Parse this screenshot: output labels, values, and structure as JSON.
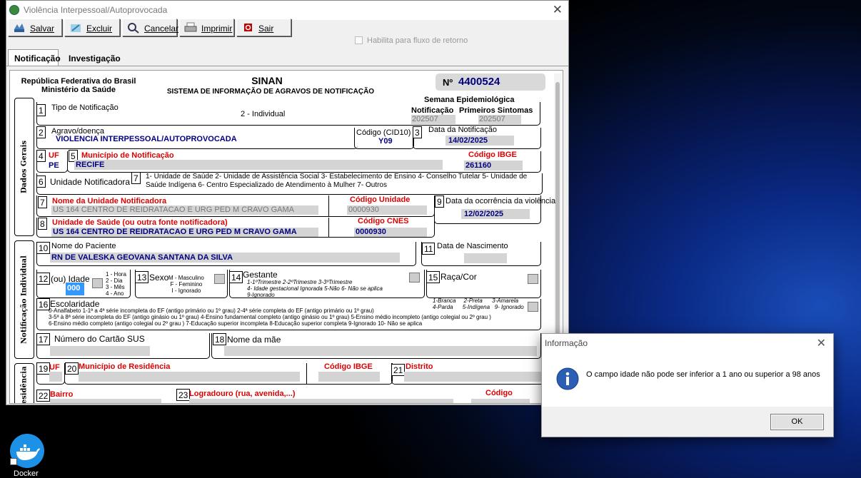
{
  "window": {
    "title": "Violência Interpessoal/Autoprovocada",
    "close": "✕"
  },
  "toolbar": {
    "save": "Salvar",
    "delete": "Excluir",
    "cancel": "Cancelar",
    "print": "Imprimir",
    "exit": "Sair"
  },
  "flow_checkbox": "Habilita para fluxo de retorno",
  "tabs": [
    "Notificação",
    "Investigação"
  ],
  "header": {
    "republic": "República Federativa do Brasil",
    "ministry": "Ministério da Saúde",
    "sinan": "SINAN",
    "system": "SISTEMA DE INFORMAÇÃO  DE AGRAVOS DE NOTIFICAÇÃO",
    "number_label": "Nº",
    "number": "4400524"
  },
  "side_labels": {
    "general": "Dados Gerais",
    "individual": "Notificação Individual",
    "residence": "Residência"
  },
  "f1": {
    "n": "1",
    "label": "Tipo de Notificação",
    "value": "2 - Individual",
    "week_title": "Semana Epidemiológica",
    "week_notif": "Notificação",
    "week_sympt": "Primeiros Sintomas",
    "week_notif_val": "202507",
    "week_sympt_val": "202507"
  },
  "f2": {
    "n": "2",
    "label": "Agravo/doença",
    "value": "VIOLENCIA INTERPESSOAL/AUTOPROVOCADA",
    "cid_label": "Código (CID10)",
    "cid": "Y09"
  },
  "f3": {
    "n": "3",
    "label": "Data da Notificação",
    "value": "14/02/2025"
  },
  "f4": {
    "n": "4",
    "label": "UF",
    "value": "PE"
  },
  "f5": {
    "n": "5",
    "label": "Município de Notificação",
    "value": "RECIFE",
    "ibge_label": "Código IBGE",
    "ibge": "261160"
  },
  "f6": {
    "n": "6",
    "label": "Unidade Notificadora",
    "n7": "7",
    "options": "1- Unidade de Saúde  2- Unidade de Assistência Social  3- Estabelecimento de Ensino  4- Conselho Tutelar  5- Unidade de Saúde Indígena  6- Centro Especializado de Atendimento à Mulher  7- Outros"
  },
  "f7": {
    "n": "7",
    "label": "Nome da Unidade Notificadora",
    "value": "US 164 CENTRO DE REIDRATACAO E URG PED M CRAVO GAMA",
    "code_label": "Código Unidade",
    "code": "0000930"
  },
  "f8": {
    "n": "8",
    "label": "Unidade de Saúde (ou outra fonte notificadora)",
    "value": "US 164 CENTRO DE REIDRATACAO E URG PED M CRAVO GAMA",
    "cnes_label": "Código CNES",
    "cnes": "0000930"
  },
  "f9": {
    "n": "9",
    "label": "Data da ocorrência da violência",
    "value": "12/02/2025"
  },
  "f10": {
    "n": "10",
    "label": "Nome do Paciente",
    "value": "RN DE VALESKA GEOVANA SANTANA DA SILVA"
  },
  "f11": {
    "n": "11",
    "label": "Data de Nascimento"
  },
  "f12": {
    "n": "12",
    "label": "(ou) Idade",
    "value": "000",
    "units": [
      "1 - Hora",
      "2 - Dia",
      "3 - Mês",
      "4 - Ano"
    ]
  },
  "f13": {
    "n": "13",
    "label": "Sexo",
    "options": [
      "M - Masculino",
      "F - Feminino",
      "I - Ignorado"
    ]
  },
  "f14": {
    "n": "14",
    "label": "Gestante",
    "l1": "1-1ºTrimestre   2-2ºTrimestre   3-3ºTrimestre",
    "l2": "4- Idade gestacional Ignorada   5-Não   6- Não se aplica",
    "l3": "9-Ignorado"
  },
  "f15": {
    "n": "15",
    "label": "Raça/Cor",
    "l1": "1-Branca     2-Preta      3-Amarela",
    "l2": "4-Parda      5-Indígena   9- Ignorado"
  },
  "f16": {
    "n": "16",
    "label": "Escolaridade",
    "l1": "0-Analfabeto    1-1ª a 4ª série incompleta do EF (antigo primário ou 1º grau)     2-4ª série completa do EF (antigo primário ou 1º grau)",
    "l2": "3-5ª à 8ª série incompleta do EF (antigo ginásio ou 1º grau)    4-Ensino fundamental completo (antigo ginásio ou 1º grau)    5-Ensino médio incompleto (antigo colegial  ou 2º grau )",
    "l3": "6-Ensino médio completo (antigo colegial  ou 2º grau )   7-Educação superior incompleta     8-Educação superior completa     9-Ignorado    10- Não se aplica"
  },
  "f17": {
    "n": "17",
    "label": "Número do Cartão SUS"
  },
  "f18": {
    "n": "18",
    "label": "Nome da mãe"
  },
  "f19": {
    "n": "19",
    "label": "UF"
  },
  "f20": {
    "n": "20",
    "label": "Município de Residência",
    "ibge_label": "Código IBGE"
  },
  "f21": {
    "n": "21",
    "label": "Distrito"
  },
  "f22": {
    "n": "22",
    "label": "Bairro"
  },
  "f23": {
    "n": "23",
    "label": "Logradouro (rua, avenida,...)",
    "code_label": "Código"
  },
  "dialog": {
    "title": "Informação",
    "message": "O campo idade não pode ser inferior a 1 ano ou superior a 98 anos",
    "ok": "OK",
    "close": "✕"
  },
  "desktop": {
    "docker": "Docker"
  }
}
